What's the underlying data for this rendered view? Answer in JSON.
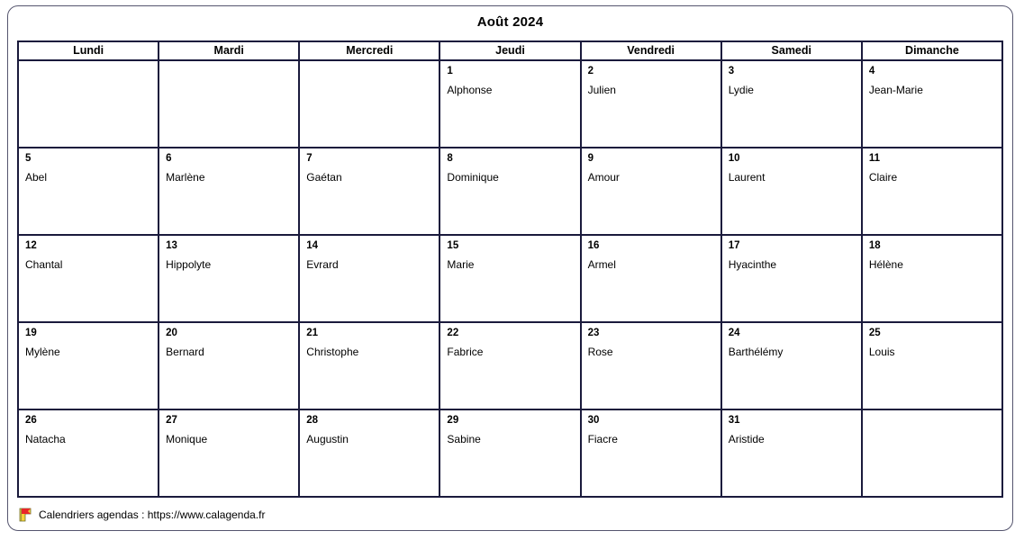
{
  "title": "Août 2024",
  "weekdays": [
    "Lundi",
    "Mardi",
    "Mercredi",
    "Jeudi",
    "Vendredi",
    "Samedi",
    "Dimanche"
  ],
  "colors": {
    "grid_border": "#1a1a3c",
    "frame_border": "#55556e",
    "background": "#ffffff",
    "text": "#000000",
    "flag_red": "#e8262a",
    "flag_yellow": "#f5d33a"
  },
  "weeks": [
    [
      {
        "day": "",
        "saint": ""
      },
      {
        "day": "",
        "saint": ""
      },
      {
        "day": "",
        "saint": ""
      },
      {
        "day": "1",
        "saint": "Alphonse"
      },
      {
        "day": "2",
        "saint": "Julien"
      },
      {
        "day": "3",
        "saint": "Lydie"
      },
      {
        "day": "4",
        "saint": "Jean-Marie"
      }
    ],
    [
      {
        "day": "5",
        "saint": "Abel"
      },
      {
        "day": "6",
        "saint": "Marlène"
      },
      {
        "day": "7",
        "saint": "Gaétan"
      },
      {
        "day": "8",
        "saint": "Dominique"
      },
      {
        "day": "9",
        "saint": "Amour"
      },
      {
        "day": "10",
        "saint": "Laurent"
      },
      {
        "day": "11",
        "saint": "Claire"
      }
    ],
    [
      {
        "day": "12",
        "saint": "Chantal"
      },
      {
        "day": "13",
        "saint": "Hippolyte"
      },
      {
        "day": "14",
        "saint": "Evrard"
      },
      {
        "day": "15",
        "saint": "Marie"
      },
      {
        "day": "16",
        "saint": "Armel"
      },
      {
        "day": "17",
        "saint": "Hyacinthe"
      },
      {
        "day": "18",
        "saint": "Hélène"
      }
    ],
    [
      {
        "day": "19",
        "saint": "Mylène"
      },
      {
        "day": "20",
        "saint": "Bernard"
      },
      {
        "day": "21",
        "saint": "Christophe"
      },
      {
        "day": "22",
        "saint": "Fabrice"
      },
      {
        "day": "23",
        "saint": "Rose"
      },
      {
        "day": "24",
        "saint": "Barthélémy"
      },
      {
        "day": "25",
        "saint": "Louis"
      }
    ],
    [
      {
        "day": "26",
        "saint": "Natacha"
      },
      {
        "day": "27",
        "saint": "Monique"
      },
      {
        "day": "28",
        "saint": "Augustin"
      },
      {
        "day": "29",
        "saint": "Sabine"
      },
      {
        "day": "30",
        "saint": "Fiacre"
      },
      {
        "day": "31",
        "saint": "Aristide"
      },
      {
        "day": "",
        "saint": ""
      }
    ]
  ],
  "footer": {
    "icon": "flag-bookmark-icon",
    "text": "Calendriers agendas : https://www.calagenda.fr"
  }
}
